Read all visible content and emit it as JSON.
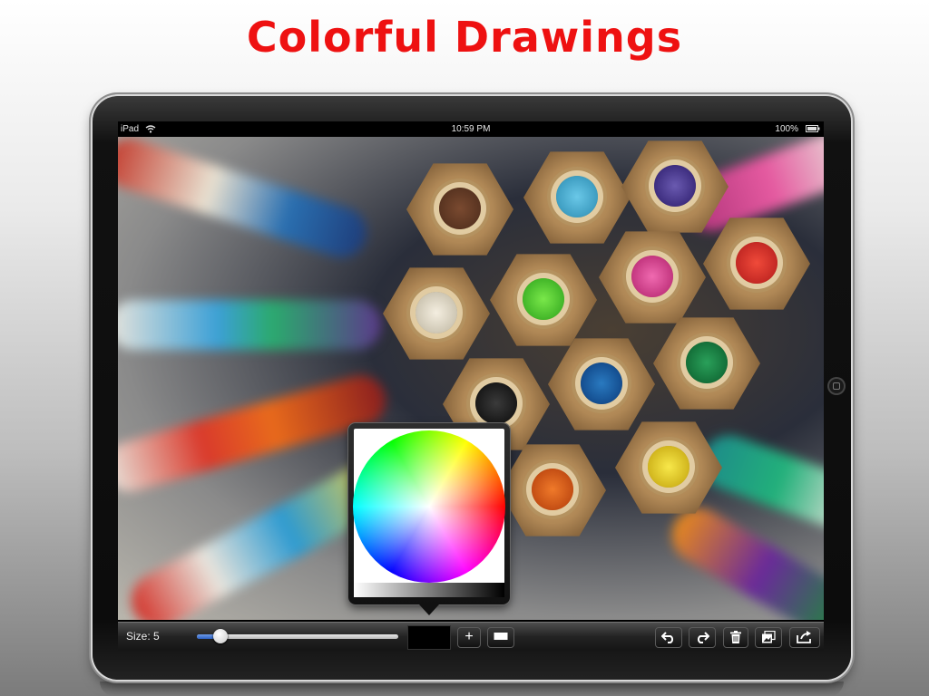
{
  "page": {
    "title": "Colorful Drawings"
  },
  "status_bar": {
    "device": "iPad",
    "time": "10:59 PM",
    "battery": "100%"
  },
  "toolbar": {
    "size_label": "Size: 5",
    "brush_size_level": 0.05,
    "current_color": "#000000",
    "buttons": {
      "plus": "+",
      "undo_icon": "undo-icon",
      "redo_icon": "redo-icon",
      "trash_icon": "trash-icon",
      "photos_icon": "photos-icon",
      "share_icon": "share-icon"
    }
  },
  "colors": {
    "title_red": "#ee1111",
    "slider_blue": "#2b61c6"
  }
}
